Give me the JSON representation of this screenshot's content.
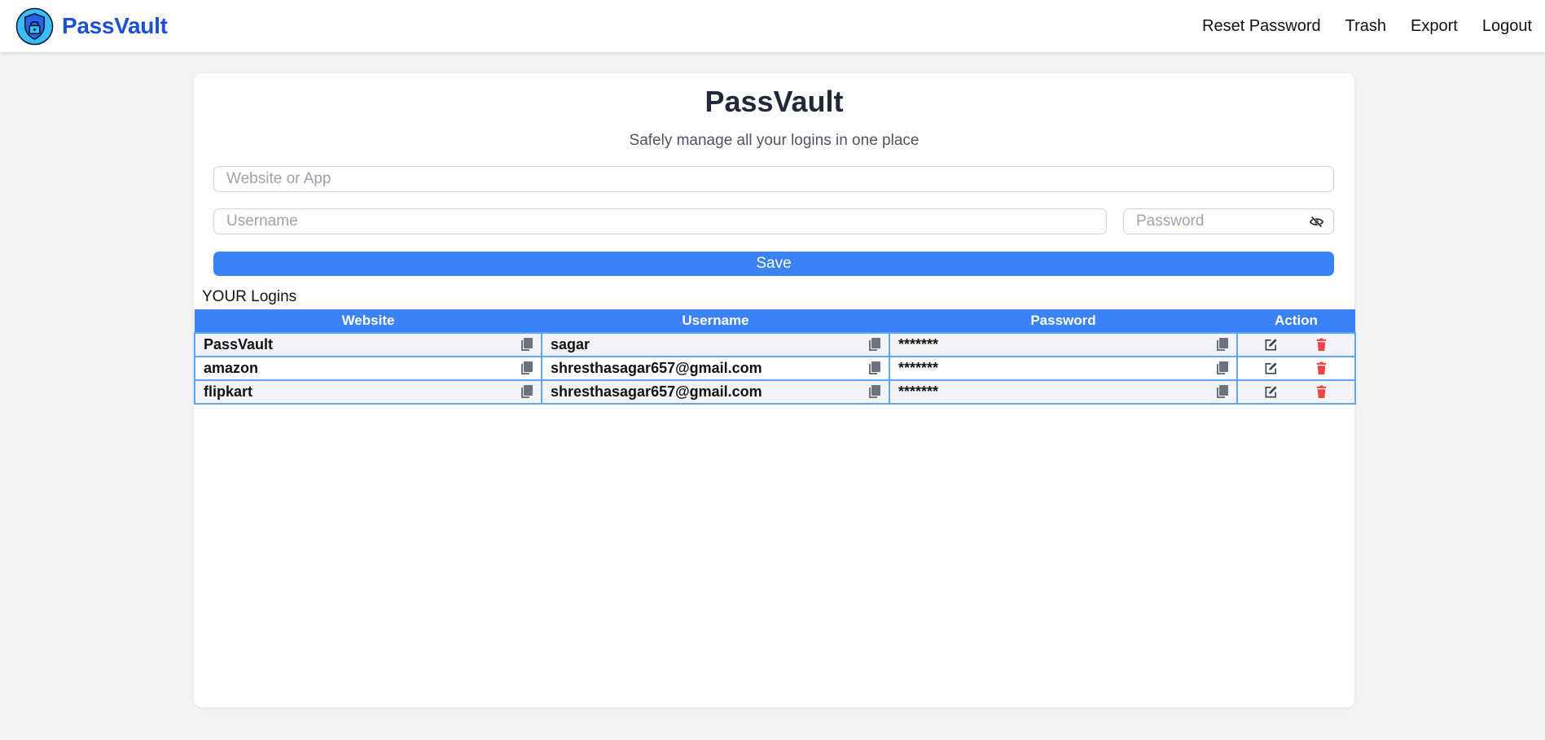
{
  "brand": {
    "name": "PassVault"
  },
  "nav": {
    "links": [
      "Reset Password",
      "Trash",
      "Export",
      "Logout"
    ]
  },
  "header": {
    "title": "PassVault",
    "subtitle": "Safely manage all your logins in one place"
  },
  "form": {
    "site_placeholder": "Website or App",
    "site_value": "",
    "username_placeholder": "Username",
    "username_value": "",
    "password_placeholder": "Password",
    "password_value": "",
    "save_label": "Save"
  },
  "logins": {
    "title": "YOUR Logins",
    "columns": [
      "Website",
      "Username",
      "Password",
      "Action"
    ],
    "rows": [
      {
        "website": "PassVault",
        "username": "sagar",
        "password": "*******"
      },
      {
        "website": "amazon",
        "username": "shresthasagar657@gmail.com",
        "password": "*******"
      },
      {
        "website": "flipkart",
        "username": "shresthasagar657@gmail.com",
        "password": "*******"
      }
    ]
  },
  "icons": {
    "logo": "shield-lock-icon",
    "password_toggle": "eye-slash-icon",
    "copy": "copy-icon",
    "edit": "edit-icon",
    "delete": "trash-icon"
  },
  "colors": {
    "brand": "#1d4ed8",
    "accent": "#3b82f6",
    "row_border": "#60a5fa",
    "delete": "#ef4444",
    "background": "#f2f3f5"
  }
}
